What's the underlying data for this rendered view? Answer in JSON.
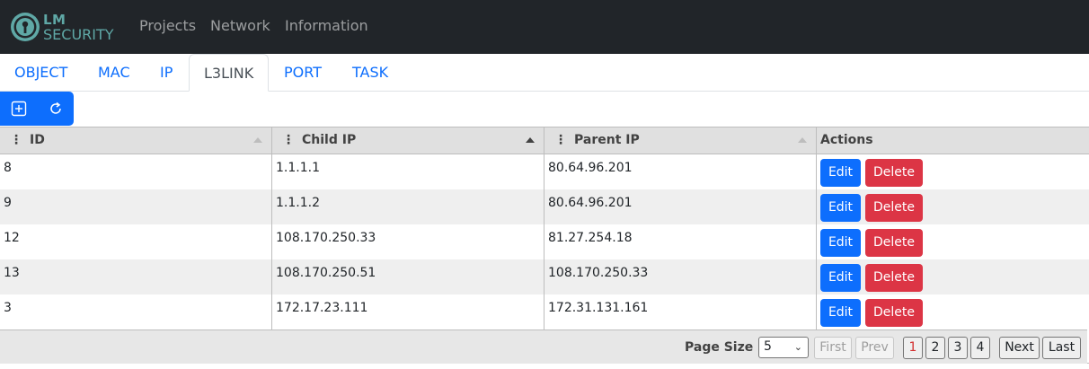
{
  "brand": {
    "line1": "LM",
    "line2": "SECURITY",
    "accent": "#5fa8a6"
  },
  "nav": {
    "items": [
      "Projects",
      "Network",
      "Information"
    ]
  },
  "tabs": {
    "items": [
      "OBJECT",
      "MAC",
      "IP",
      "L3LINK",
      "PORT",
      "TASK"
    ],
    "active": "L3LINK"
  },
  "toolbar": {
    "add_icon": "plus-square-icon",
    "refresh_icon": "refresh-icon"
  },
  "table": {
    "columns": [
      "ID",
      "Child IP",
      "Parent IP",
      "Actions"
    ],
    "sorted_column": "Child IP",
    "rows": [
      {
        "id": "8",
        "child_ip": "1.1.1.1",
        "parent_ip": "80.64.96.201"
      },
      {
        "id": "9",
        "child_ip": "1.1.1.2",
        "parent_ip": "80.64.96.201"
      },
      {
        "id": "12",
        "child_ip": "108.170.250.33",
        "parent_ip": "81.27.254.18"
      },
      {
        "id": "13",
        "child_ip": "108.170.250.51",
        "parent_ip": "108.170.250.33"
      },
      {
        "id": "3",
        "child_ip": "172.17.23.111",
        "parent_ip": "172.31.131.161"
      }
    ],
    "edit_label": "Edit",
    "delete_label": "Delete"
  },
  "paging": {
    "page_size_label": "Page Size",
    "page_size_value": "5",
    "first": "First",
    "prev": "Prev",
    "pages": [
      "1",
      "2",
      "3",
      "4"
    ],
    "current_page": "1",
    "next": "Next",
    "last": "Last"
  },
  "colors": {
    "primary": "#0d6efd",
    "danger": "#dc3545",
    "navbar": "#212529"
  }
}
